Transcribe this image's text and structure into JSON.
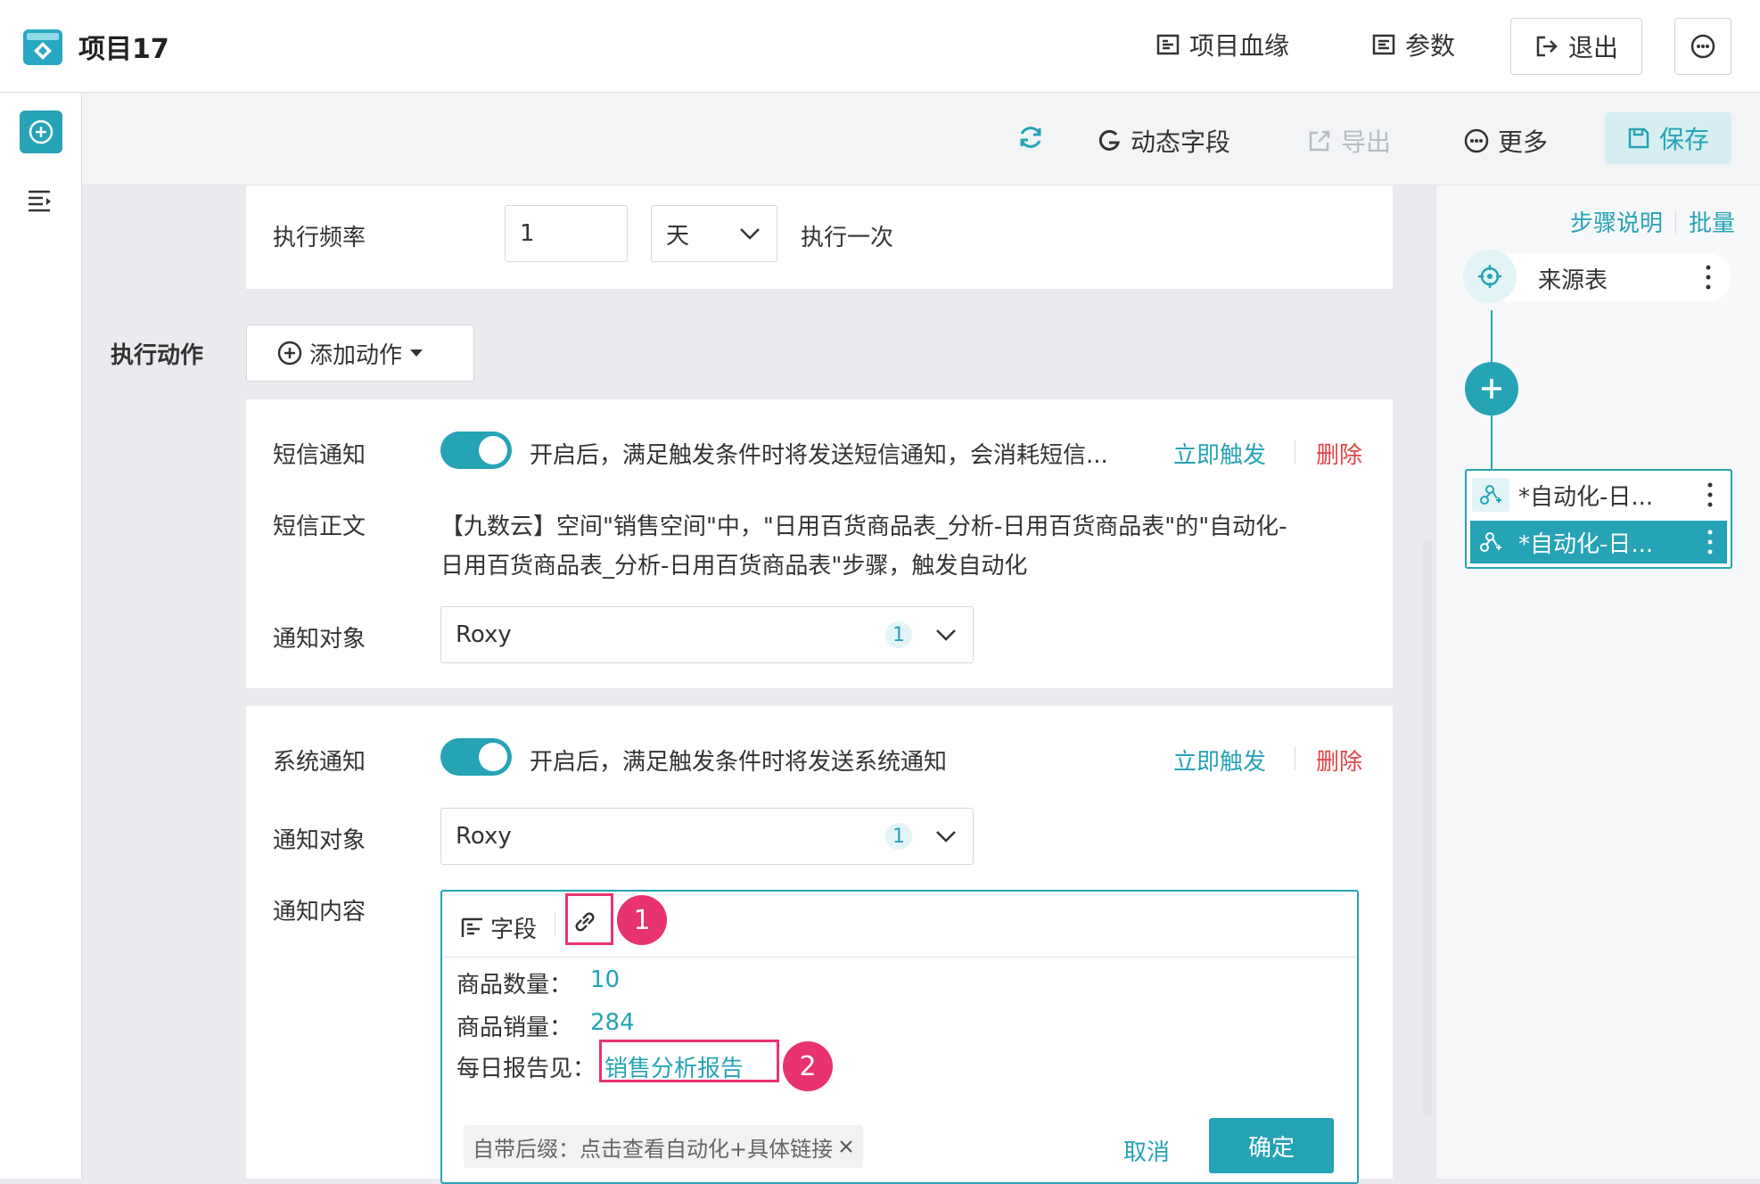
{
  "header": {
    "title": "项目17",
    "lineage": "项目血缘",
    "params": "参数",
    "exit": "退出"
  },
  "toolbar": {
    "dynamic_field": "动态字段",
    "export": "导出",
    "more": "更多",
    "save": "保存"
  },
  "frequency": {
    "label": "执行频率",
    "value": "1",
    "unit": "天",
    "suffix": "执行一次"
  },
  "actions": {
    "label": "执行动作",
    "add": "添加动作"
  },
  "sms": {
    "label": "短信通知",
    "desc": "开启后，满足触发条件时将发送短信通知，会消耗短信...",
    "trigger": "立即触发",
    "delete": "删除",
    "body_label": "短信正文",
    "body_line1": "【九数云】空间\"销售空间\"中，\"日用百货商品表_分析-日用百货商品表\"的\"自动化-",
    "body_line2": "日用百货商品表_分析-日用百货商品表\"步骤，触发自动化",
    "target_label": "通知对象",
    "target": "Roxy",
    "target_count": "1"
  },
  "system": {
    "label": "系统通知",
    "desc": "开启后，满足触发条件时将发送系统通知",
    "trigger": "立即触发",
    "delete": "删除",
    "target_label": "通知对象",
    "target": "Roxy",
    "target_count": "1",
    "content_label": "通知内容"
  },
  "editor": {
    "field_button": "字段",
    "marker1": "1",
    "marker2": "2",
    "line1_label": "商品数量：",
    "line1_value": "10",
    "line2_label": "商品销量：",
    "line2_value": "284",
    "line3_label": "每日报告见：",
    "line3_link": "销售分析报告",
    "suffix_tag": "自带后缀：点击查看自动化+具体链接",
    "cancel": "取消",
    "confirm": "确定"
  },
  "steps": {
    "help": "步骤说明",
    "batch": "批量",
    "source": "来源表",
    "step1": "*自动化-日...",
    "step2": "*自动化-日..."
  },
  "colors": {
    "accent": "#26a3b5",
    "danger": "#e64545",
    "highlight": "#e8336e"
  }
}
